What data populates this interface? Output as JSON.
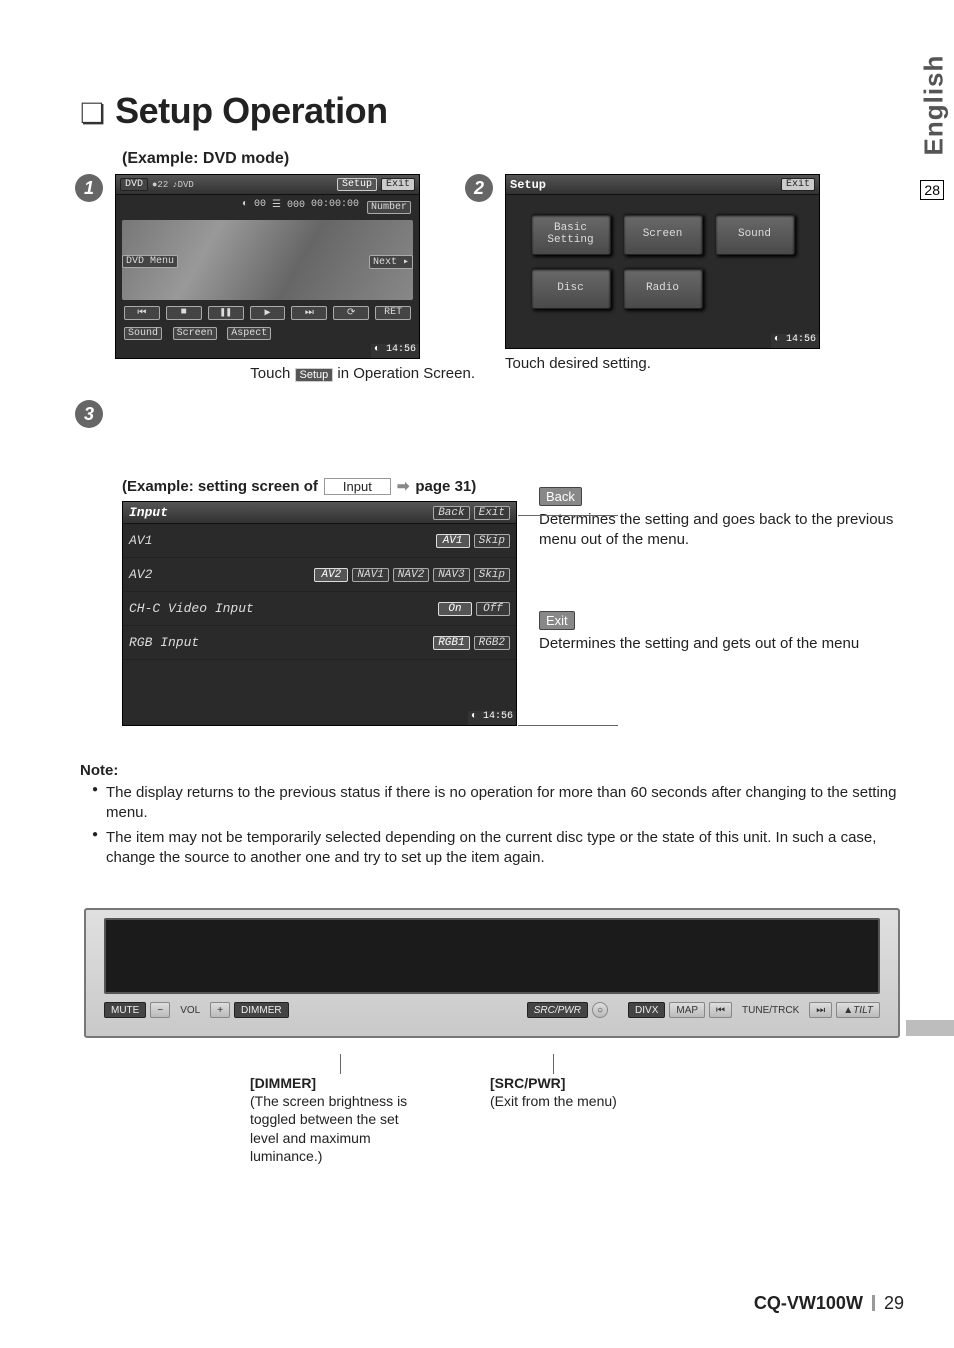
{
  "sidebar": {
    "language": "English",
    "tocPage": "28"
  },
  "title": "Setup Operation",
  "exampleLabel": "(Example: DVD mode)",
  "steps": {
    "s1": "1",
    "s2": "2",
    "s3": "3"
  },
  "screen1": {
    "header": {
      "dvd": "DVD",
      "oss": "●22",
      "note": "♪DVD",
      "setup": "Setup",
      "exit": "Exit"
    },
    "sub": {
      "chap": "◐ 00",
      "title": "☰ 000",
      "time": "00:00:00",
      "number": "Number"
    },
    "dvdmenu": "DVD Menu",
    "next": "Next ▸",
    "ctrl": {
      "prev": "⏮",
      "stop": "■",
      "pause": "❚❚",
      "play": "▶",
      "next": "⏭",
      "loop": "⟳",
      "ret": "RET"
    },
    "bottom": {
      "sound": "Sound",
      "screen": "Screen",
      "aspect": "Aspect"
    },
    "clock": "◐ 14:56"
  },
  "caption1": {
    "pre": "Touch ",
    "tag": "Setup",
    "post": " in Operation Screen."
  },
  "screen2": {
    "title": "Setup",
    "exit": "Exit",
    "tiles": {
      "basic": "Basic Setting",
      "screen": "Screen",
      "sound": "Sound",
      "disc": "Disc",
      "radio": "Radio"
    },
    "clock": "◐ 14:56"
  },
  "caption2": "Touch desired setting.",
  "step3Header": {
    "pre": "(Example: setting screen of ",
    "box": "Input",
    "arrow": "➡",
    "post": " page 31)"
  },
  "screen3": {
    "title": "Input",
    "back": "Back",
    "exit": "Exit",
    "rows": {
      "av1": {
        "label": "AV1",
        "btn1": "AV1",
        "btn2": "Skip"
      },
      "av2": {
        "label": "AV2",
        "btns": [
          "AV2",
          "NAV1",
          "NAV2",
          "NAV3",
          "Skip"
        ]
      },
      "chc": {
        "label": "CH-C Video Input",
        "on": "On",
        "off": "Off"
      },
      "rgb": {
        "label": "RGB Input",
        "r1": "RGB1",
        "r2": "RGB2"
      }
    },
    "clock": "◐ 14:56"
  },
  "backDesc": {
    "tag": "Back",
    "text": "Determines the setting and goes back to the previous menu out of the menu."
  },
  "exitDesc": {
    "tag": "Exit",
    "text": "Determines the setting and gets out of the menu"
  },
  "note": {
    "title": "Note:",
    "item1": "The display returns to the previous status if there is no operation for more than 60 seconds after changing to the setting menu.",
    "item2": "The item may not be temporarily selected depending on the current disc type or the state of this unit. In such a case, change the source to another one and try to set up the item again."
  },
  "device": {
    "buttons": {
      "mute": "MUTE",
      "minus": "−",
      "vol": "VOL",
      "plus": "+",
      "dimmer": "DIMMER",
      "src": "SRC/PWR",
      "circle": "○",
      "divx": "DIVX",
      "map": "MAP",
      "prev": "⏮",
      "tune": "TUNE/TRCK",
      "next": "⏭",
      "tilt": "▲TILT"
    }
  },
  "legends": {
    "dimmer": {
      "title": "[DIMMER]",
      "text": "(The screen brightness is toggled between the set level and maximum luminance.)"
    },
    "src": {
      "title": "[SRC/PWR]",
      "text": "(Exit from the menu)"
    }
  },
  "footer": {
    "model": "CQ-VW100W",
    "page": "29"
  }
}
